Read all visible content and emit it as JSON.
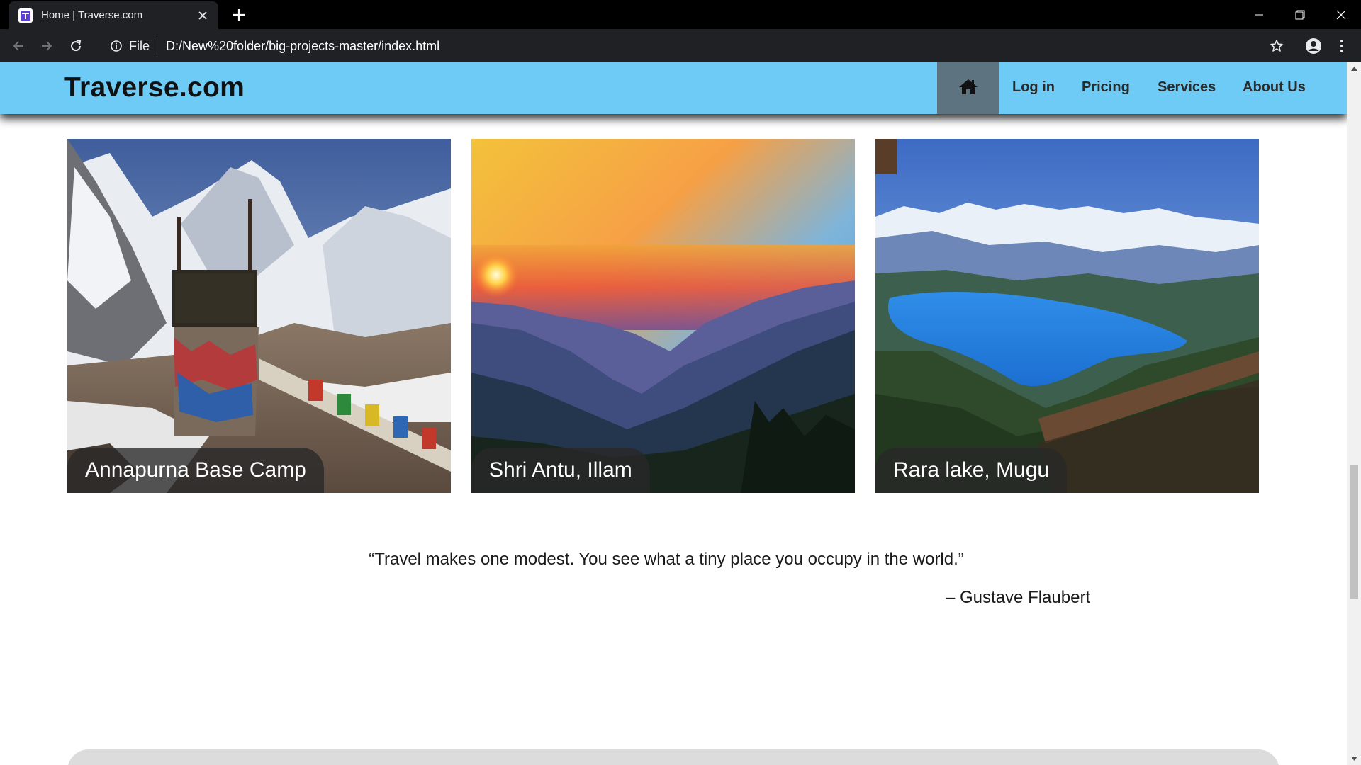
{
  "browser": {
    "tab_title": "Home | Traverse.com",
    "favicon_icon": "traverse-logo-icon",
    "address_prefix": "File",
    "url": "D:/New%20folder/big-projects-master/index.html"
  },
  "site": {
    "brand": "Traverse.com",
    "nav": {
      "home_icon": "home-icon",
      "login": "Log in",
      "pricing": "Pricing",
      "services": "Services",
      "about": "About Us"
    },
    "colors": {
      "nav_bg": "#6ecbf5",
      "home_bg": "#5d7480"
    }
  },
  "gallery": {
    "cards": [
      {
        "caption": "Annapurna Base Camp",
        "image": "snowy mountains with prayer flags and base camp sign"
      },
      {
        "caption": "Shri Antu, Illam",
        "image": "sunset over layered hills"
      },
      {
        "caption": "Rara lake, Mugu",
        "image": "blue lake among forested hills and snowy peaks"
      }
    ]
  },
  "quote": {
    "text": "“Travel makes one modest. You see what a tiny place you occupy in the world.”",
    "author": "– Gustave Flaubert"
  }
}
